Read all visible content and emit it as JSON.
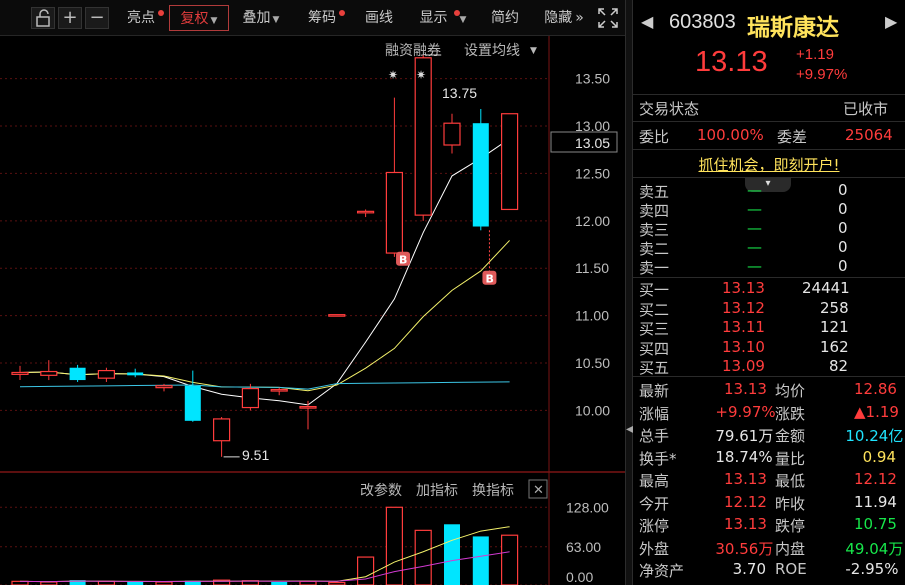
{
  "toolbar": {
    "lock_icon": "unlock-icon",
    "zoom_in": "+",
    "zoom_out": "−",
    "buttons": [
      {
        "label": "亮点",
        "dot": true
      },
      {
        "label": "复权",
        "dot": false,
        "selected": true,
        "dropdown": true
      },
      {
        "label": "叠加",
        "dot": false,
        "dropdown": true
      },
      {
        "label": "筹码",
        "dot": true
      },
      {
        "label": "画线",
        "dot": false
      },
      {
        "label": "显示",
        "dot": true,
        "dropdown": true
      },
      {
        "label": "简约",
        "dot": false
      },
      {
        "label": "隐藏",
        "dot": false
      }
    ],
    "more": "»",
    "fullscreen_icon": "expand-icon"
  },
  "chart": {
    "links": {
      "margin": "融资融券",
      "ma_setting": "设置均线"
    },
    "indicator_links": {
      "params": "改参数",
      "add": "加指标",
      "switch": "换指标"
    },
    "price_label": "13.05",
    "high_mark": "13.75",
    "low_mark": "9.51",
    "buy_badge": "B",
    "colors": {
      "up": "#ff3c3c",
      "down": "#00e5ff",
      "ma5": "#ffffff",
      "ma10": "#f4f26b",
      "ma20": "#3cc6e6",
      "vol_ma": "#d23ad2"
    }
  },
  "chart_data": [
    {
      "type": "candlestick",
      "y_ticks": [
        "13.50",
        "13.00",
        "12.50",
        "12.00",
        "11.50",
        "11.00",
        "10.50",
        "10.00"
      ],
      "ylim": [
        9.35,
        13.95
      ],
      "candles": [
        {
          "o": 10.38,
          "h": 10.47,
          "l": 10.32,
          "c": 10.4
        },
        {
          "o": 10.37,
          "h": 10.53,
          "l": 10.32,
          "c": 10.41
        },
        {
          "o": 10.45,
          "h": 10.48,
          "l": 10.3,
          "c": 10.32
        },
        {
          "o": 10.34,
          "h": 10.45,
          "l": 10.3,
          "c": 10.42
        },
        {
          "o": 10.4,
          "h": 10.44,
          "l": 10.35,
          "c": 10.37
        },
        {
          "o": 10.24,
          "h": 10.28,
          "l": 10.2,
          "c": 10.26
        },
        {
          "o": 10.26,
          "h": 10.42,
          "l": 9.88,
          "c": 9.89
        },
        {
          "o": 9.68,
          "h": 9.93,
          "l": 9.51,
          "c": 9.91
        },
        {
          "o": 10.03,
          "h": 10.28,
          "l": 10.0,
          "c": 10.23
        },
        {
          "o": 10.22,
          "h": 10.24,
          "l": 10.16,
          "c": 10.22
        },
        {
          "o": 10.03,
          "h": 10.1,
          "l": 9.8,
          "c": 10.04
        },
        {
          "o": 11.01,
          "h": 11.01,
          "l": 11.01,
          "c": 11.01
        },
        {
          "o": 12.1,
          "h": 12.12,
          "l": 12.04,
          "c": 12.1
        },
        {
          "o": 11.66,
          "h": 13.3,
          "l": 11.62,
          "c": 12.51
        },
        {
          "o": 12.06,
          "h": 13.75,
          "l": 12.0,
          "c": 13.72
        },
        {
          "o": 12.8,
          "h": 13.13,
          "l": 12.71,
          "c": 13.03
        },
        {
          "o": 13.03,
          "h": 13.18,
          "l": 11.9,
          "c": 11.94
        },
        {
          "o": 12.12,
          "h": 13.13,
          "l": 12.12,
          "c": 13.13
        }
      ]
    },
    {
      "type": "bar",
      "title": "volume",
      "y_ticks": [
        "128.00",
        "63.00",
        "0.00"
      ],
      "ylim": [
        0,
        140
      ],
      "values": [
        6,
        5,
        8,
        6,
        5,
        5,
        7,
        8,
        7,
        5,
        6,
        4,
        46,
        128,
        90,
        100,
        80,
        82
      ],
      "up": [
        true,
        true,
        false,
        true,
        false,
        true,
        false,
        true,
        true,
        false,
        true,
        true,
        true,
        true,
        true,
        false,
        false,
        true
      ]
    }
  ],
  "quote": {
    "code": "603803",
    "name": "瑞斯康达",
    "price": "13.13",
    "change": "+1.19",
    "change_pct": "+9.97%",
    "status_label": "交易状态",
    "status_value": "已收市",
    "wb_label": "委比",
    "wb_value": "100.00%",
    "wc_label": "委差",
    "wc_value": "25064",
    "promo": "抓住机会，即刻开户!",
    "asks": [
      {
        "label": "卖五",
        "price": "—",
        "vol": "0"
      },
      {
        "label": "卖四",
        "price": "—",
        "vol": "0"
      },
      {
        "label": "卖三",
        "price": "—",
        "vol": "0"
      },
      {
        "label": "卖二",
        "price": "—",
        "vol": "0"
      },
      {
        "label": "卖一",
        "price": "—",
        "vol": "0"
      }
    ],
    "bids": [
      {
        "label": "买一",
        "price": "13.13",
        "vol": "24441"
      },
      {
        "label": "买二",
        "price": "13.12",
        "vol": "258"
      },
      {
        "label": "买三",
        "price": "13.11",
        "vol": "121"
      },
      {
        "label": "买四",
        "price": "13.10",
        "vol": "162"
      },
      {
        "label": "买五",
        "price": "13.09",
        "vol": "82"
      }
    ],
    "stats": [
      {
        "l1": "最新",
        "v1": "13.13",
        "c1": "red",
        "l2": "均价",
        "v2": "12.86",
        "c2": "red"
      },
      {
        "l1": "涨幅",
        "v1": "+9.97%",
        "c1": "red",
        "l2": "涨跌",
        "v2": "▲1.19",
        "c2": "red"
      },
      {
        "l1": "总手",
        "v1": "79.61万",
        "c1": "white",
        "l2": "金额",
        "v2": "10.24亿",
        "c2": "cyan"
      },
      {
        "l1": "换手*",
        "v1": "18.74%",
        "c1": "white",
        "l2": "量比",
        "v2": "0.94",
        "c2": "yellow"
      },
      {
        "l1": "最高",
        "v1": "13.13",
        "c1": "red",
        "l2": "最低",
        "v2": "12.12",
        "c2": "red"
      },
      {
        "l1": "今开",
        "v1": "12.12",
        "c1": "red",
        "l2": "昨收",
        "v2": "11.94",
        "c2": "white"
      },
      {
        "l1": "涨停",
        "v1": "13.13",
        "c1": "red",
        "l2": "跌停",
        "v2": "10.75",
        "c2": "green"
      },
      {
        "l1": "外盘",
        "v1": "30.56万",
        "c1": "red",
        "l2": "内盘",
        "v2": "49.04万",
        "c2": "green"
      },
      {
        "l1": "净资产",
        "v1": "3.70",
        "c1": "white",
        "l2": "ROE",
        "v2": "-2.95%",
        "c2": "white"
      }
    ]
  }
}
